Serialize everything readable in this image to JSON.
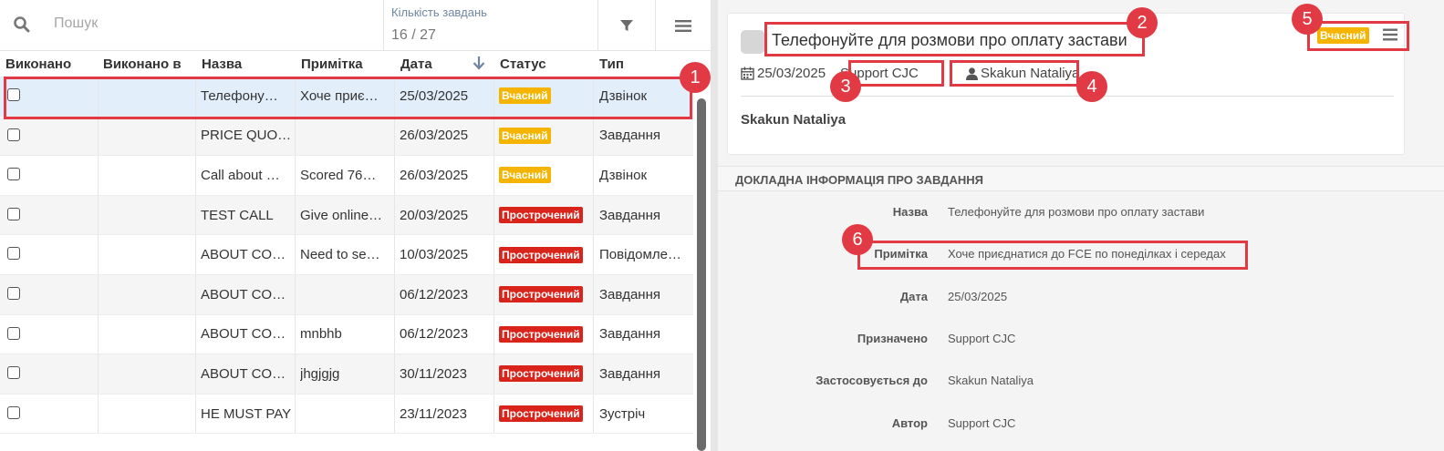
{
  "left": {
    "search_placeholder": "Пошук",
    "task_count_label": "Кількість завдань",
    "task_count_value": "16 / 27",
    "columns": [
      "Виконано",
      "Виконано в",
      "Назва",
      "Примітка",
      "Дата",
      "Статус",
      "Тип"
    ],
    "rows": [
      {
        "name": "Телефону…",
        "note": "Хоче приє…",
        "date": "25/03/2025",
        "status": "Вчасний",
        "type": "Дзвінок"
      },
      {
        "name": "PRICE QUO…",
        "note": "",
        "date": "26/03/2025",
        "status": "Вчасний",
        "type": "Завдання"
      },
      {
        "name": "Call about …",
        "note": "Scored 76…",
        "date": "26/03/2025",
        "status": "Вчасний",
        "type": "Дзвінок"
      },
      {
        "name": "TEST CALL",
        "note": "Give online…",
        "date": "20/03/2025",
        "status": "Прострочений",
        "type": "Завдання"
      },
      {
        "name": "ABOUT CO…",
        "note": "Need to se…",
        "date": "10/03/2025",
        "status": "Прострочений",
        "type": "Повідомле…"
      },
      {
        "name": "ABOUT CO…",
        "note": "",
        "date": "06/12/2023",
        "status": "Прострочений",
        "type": "Завдання"
      },
      {
        "name": "ABOUT CO…",
        "note": "mnbhb",
        "date": "06/12/2023",
        "status": "Прострочений",
        "type": "Завдання"
      },
      {
        "name": "ABOUT CO…",
        "note": "jhgjgjg",
        "date": "30/11/2023",
        "status": "Прострочений",
        "type": "Завдання"
      },
      {
        "name": "HE MUST PAY",
        "note": "",
        "date": "23/11/2023",
        "status": "Прострочений",
        "type": "Зустріч"
      }
    ]
  },
  "card": {
    "title": "Телефонуйте для розмови про оплату застави",
    "status": "Вчасний",
    "date": "25/03/2025",
    "assignee": "Support CJC",
    "contact": "Skakun Nataliya",
    "applied_to": "Skakun Nataliya"
  },
  "details": {
    "heading": "ДОКЛАДНА ІНФОРМАЦІЯ ПРО ЗАВДАННЯ",
    "fields": [
      {
        "label": "Назва",
        "value": "Телефонуйте для розмови про оплату застави"
      },
      {
        "label": "Примітка",
        "value": "Хоче приєднатися до FCE по понеділках і середах"
      },
      {
        "label": "Дата",
        "value": "25/03/2025"
      },
      {
        "label": "Призначено",
        "value": "Support CJC"
      },
      {
        "label": "Застосовується до",
        "value": "Skakun Nataliya"
      },
      {
        "label": "Автор",
        "value": "Support CJC"
      }
    ]
  },
  "annotations": [
    "1",
    "2",
    "3",
    "4",
    "5",
    "6"
  ],
  "colors": {
    "highlight": "#e23a44",
    "on_time": "#f4b400",
    "overdue": "#d9241b",
    "selected_row": "#e3eefb"
  }
}
